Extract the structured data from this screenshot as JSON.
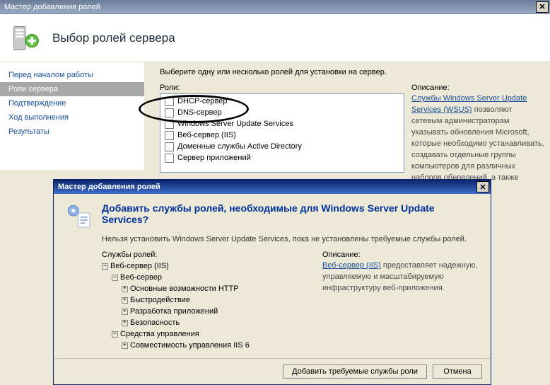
{
  "window": {
    "title": "Мастер добавления ролей",
    "page_title": "Выбор ролей сервера"
  },
  "nav": {
    "items": [
      {
        "label": "Перед началом работы"
      },
      {
        "label": "Роли сервера"
      },
      {
        "label": "Подтверждение"
      },
      {
        "label": "Ход выполнения"
      },
      {
        "label": "Результаты"
      }
    ],
    "active_index": 1
  },
  "main": {
    "instruction": "Выберите одну или несколько ролей для установки на сервер.",
    "roles_label": "Роли:",
    "roles": [
      "DHCP-сервер",
      "DNS-сервер",
      "Windows Server Update Services",
      "Веб-сервер (IIS)",
      "Доменные службы Active Directory",
      "Сервер приложений"
    ],
    "desc_label": "Описание:",
    "desc_link": "Службы Windows Server Update Services (WSUS)",
    "desc_text": " позволяют сетевым администраторам указывать обновления Microsoft, которые необходимо устанавливать, создавать отдельные группы компьютеров для различных наборов обновлений, а также"
  },
  "dialog": {
    "title": "Мастер добавления ролей",
    "heading": "Добавить службы ролей, необходимые для Windows Server Update Services?",
    "subtext": "Нельзя установить Windows Server Update Services, пока не установлены требуемые службы ролей.",
    "services_label": "Службы ролей:",
    "desc_label": "Описание:",
    "desc_link": "Веб-сервер (IIS)",
    "desc_text": " предоставляет надежную, управляемую и масштабируемую инфраструктуру веб-приложения.",
    "tree": [
      {
        "level": 0,
        "exp": "-",
        "label": "Веб-сервер (IIS)"
      },
      {
        "level": 1,
        "exp": "-",
        "label": "Веб-сервер"
      },
      {
        "level": 2,
        "exp": "+",
        "label": "Основные возможности HTTP"
      },
      {
        "level": 2,
        "exp": "+",
        "label": "Быстродействие"
      },
      {
        "level": 2,
        "exp": "+",
        "label": "Разработка приложений"
      },
      {
        "level": 2,
        "exp": "+",
        "label": "Безопасность"
      },
      {
        "level": 1,
        "exp": "-",
        "label": "Средства управления"
      },
      {
        "level": 2,
        "exp": "+",
        "label": "Совместимость управления IIS 6"
      }
    ],
    "buttons": {
      "add": "Добавить требуемые службы роли",
      "cancel": "Отмена"
    }
  }
}
